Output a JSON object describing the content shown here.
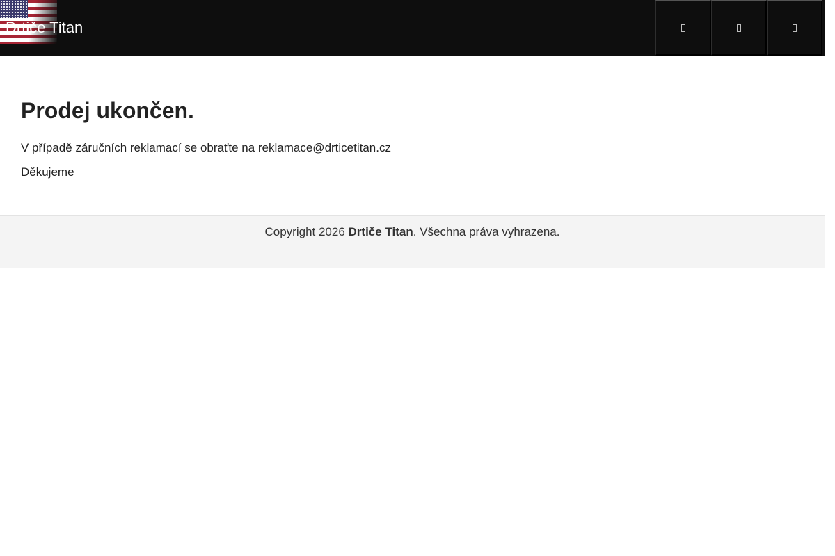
{
  "header": {
    "brand": "Drtiče Titan",
    "flag": "us-flag",
    "actions": [
      {
        "icon": "search-icon"
      },
      {
        "icon": "user-icon"
      },
      {
        "icon": "menu-icon"
      }
    ]
  },
  "main": {
    "title": "Prodej ukončen.",
    "paragraph_1": "V případě záručních reklamací se obraťte na reklamace@drticetitan.cz",
    "paragraph_2": "Děkujeme"
  },
  "footer": {
    "prefix": "Copyright 2026 ",
    "brand": "Drtiče Titan",
    "suffix": ". Všechna práva vyhrazena."
  },
  "colors": {
    "header_bg": "#0e0e0e",
    "text": "#222222",
    "footer_bg": "#f4f4f4"
  }
}
